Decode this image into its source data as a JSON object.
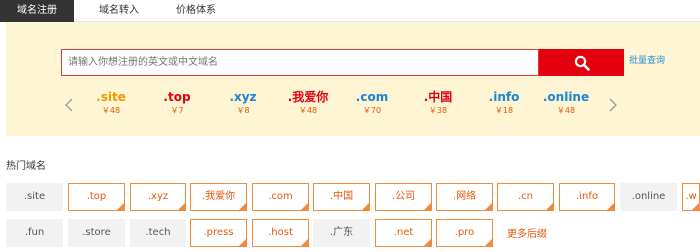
{
  "tabs": [
    "域名注册",
    "域名转入",
    "价格体系"
  ],
  "search": {
    "placeholder": "请输入你想注册的英文或中文域名",
    "batch_label": "批量查询"
  },
  "suffixes": [
    {
      "name": ".site",
      "price": "￥48",
      "color": "#f39800"
    },
    {
      "name": ".top",
      "price": "￥7",
      "color": "#e4000f"
    },
    {
      "name": ".xyz",
      "price": "￥8",
      "color": "#1c86d1"
    },
    {
      "name": ".我爱你",
      "price": "￥48",
      "color": "#e4000f"
    },
    {
      "name": ".com",
      "price": "￥70",
      "color": "#1c86d1"
    },
    {
      "name": ".中国",
      "price": "￥38",
      "color": "#e4000f"
    },
    {
      "name": ".info",
      "price": "￥18",
      "color": "#1c86d1"
    },
    {
      "name": ".online",
      "price": "￥48",
      "color": "#1c86d1"
    }
  ],
  "hot": {
    "title": "热门域名",
    "more_label": "更多后缀",
    "row1": [
      {
        "name": ".site",
        "hl": false
      },
      {
        "name": ".top",
        "hl": true
      },
      {
        "name": ".xyz",
        "hl": true
      },
      {
        "name": ".我爱你",
        "hl": true
      },
      {
        "name": ".com",
        "hl": true
      },
      {
        "name": ".中国",
        "hl": true
      },
      {
        "name": ".公司",
        "hl": true
      },
      {
        "name": ".网络",
        "hl": true
      },
      {
        "name": ".cn",
        "hl": true
      },
      {
        "name": ".info",
        "hl": true
      },
      {
        "name": ".online",
        "hl": false
      },
      {
        "name": ".w",
        "hl": true
      }
    ],
    "row2": [
      {
        "name": ".fun",
        "hl": false
      },
      {
        "name": ".store",
        "hl": false
      },
      {
        "name": ".tech",
        "hl": false
      },
      {
        "name": ".press",
        "hl": true
      },
      {
        "name": ".host",
        "hl": true
      },
      {
        "name": ".广东",
        "hl": false
      },
      {
        "name": ".net",
        "hl": true
      },
      {
        "name": ".pro",
        "hl": true
      }
    ]
  }
}
